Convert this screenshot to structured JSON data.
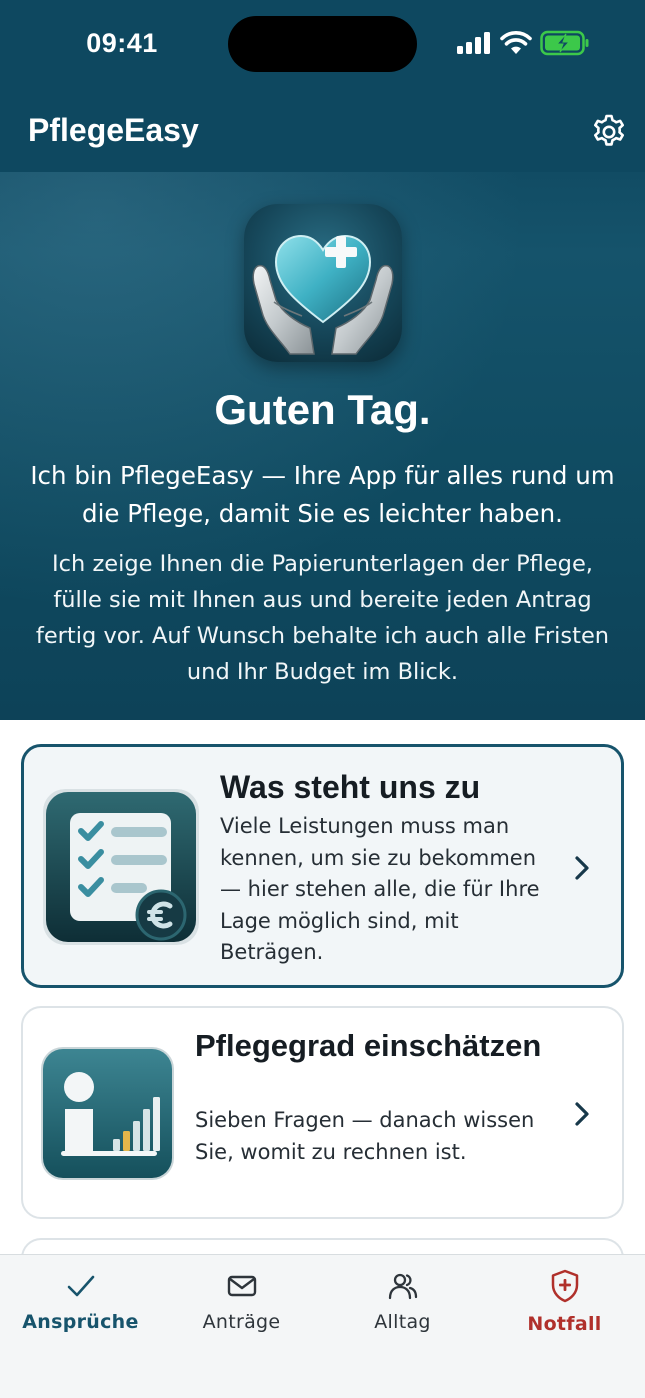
{
  "status_bar": {
    "time": "09:41"
  },
  "header": {
    "title": "PflegeEasy",
    "settings_icon": "gear-icon"
  },
  "hero": {
    "logo_icon": "heart-hands-icon",
    "greeting": "Guten Tag.",
    "intro": "Ich bin PflegeEasy — Ihre App für alles rund um die Pflege, damit Sie es leichter haben.",
    "description": "Ich zeige Ihnen die Papierunterlagen der Pflege, fülle sie mit Ihnen aus und bereite jeden Antrag fertig vor. Auf Wunsch behalte ich auch alle Fristen und Ihr Budget im Blick."
  },
  "cards": [
    {
      "title": "Was steht uns zu",
      "description": "Viele Leistungen muss man kennen, um sie zu bekommen — hier stehen alle, die für Ihre Lage möglich sind, mit Beträgen.",
      "icon": "checklist-euro-icon",
      "selected": true
    },
    {
      "title": "Pflegegrad einschätzen",
      "description": "Sieben Fragen — danach wissen Sie, womit zu rechnen ist.",
      "icon": "person-bar-chart-icon",
      "selected": false
    }
  ],
  "tabbar": {
    "tabs": [
      {
        "label": "Ansprüche",
        "icon": "checkmark-icon",
        "active": true
      },
      {
        "label": "Anträge",
        "icon": "envelope-icon",
        "active": false
      },
      {
        "label": "Alltag",
        "icon": "people-icon",
        "active": false
      },
      {
        "label": "Notfall",
        "icon": "shield-cross-icon",
        "active": false
      }
    ]
  },
  "colors": {
    "header_bg": "#0e4860",
    "accent": "#17546c",
    "emergency": "#b0302b",
    "battery_green": "#3cc84a"
  }
}
